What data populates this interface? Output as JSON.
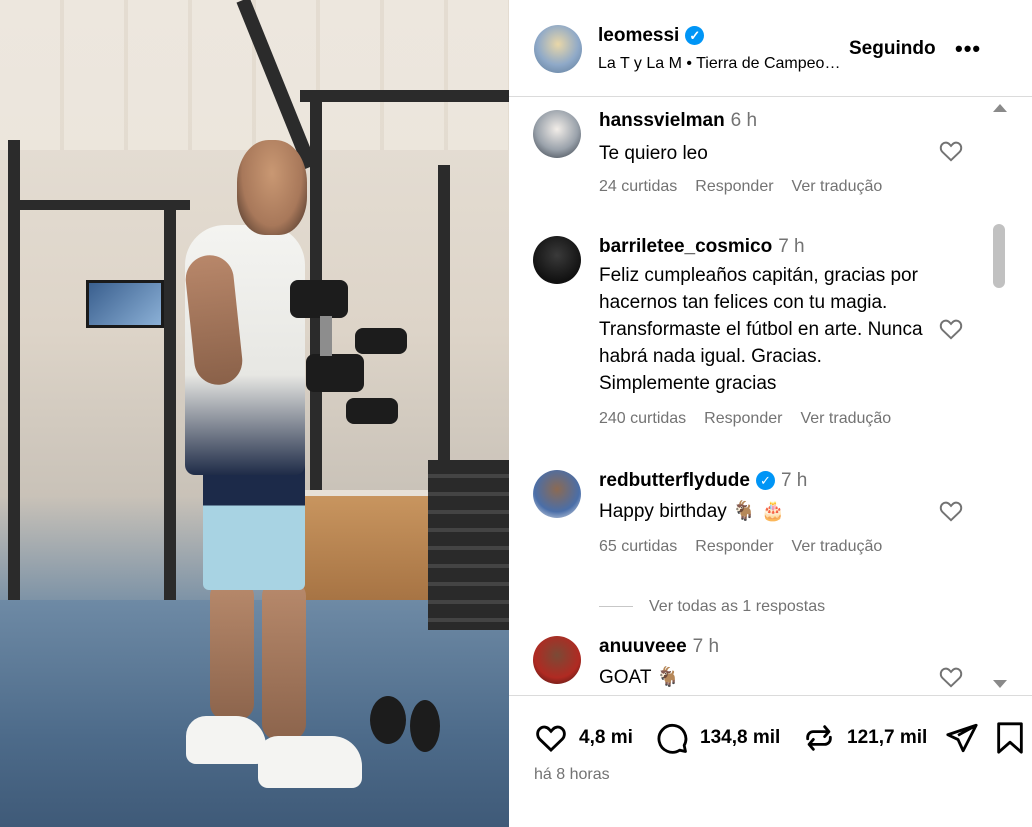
{
  "post": {
    "username": "leomessi",
    "location": "La T y La M • Tierra de Campeones",
    "follow_label": "Seguindo",
    "more_label": "•••",
    "time_ago": "há 8 horas"
  },
  "comments": [
    {
      "username": "hanssvielman",
      "time": "6 h",
      "text": "Te quiero leo",
      "likes": "24 curtidas",
      "reply_label": "Responder",
      "translate_label": "Ver tradução",
      "verified": false
    },
    {
      "username": "barriletee_cosmico",
      "time": "7 h",
      "text": "Feliz cumpleaños capitán, gracias por hacernos tan felices con tu magia. Transformaste el fútbol en arte. Nunca habrá nada igual. Gracias. Simplemente gracias",
      "likes": "240 curtidas",
      "reply_label": "Responder",
      "translate_label": "Ver tradução",
      "verified": false
    },
    {
      "username": "redbutterflydude",
      "time": "7 h",
      "text": "Happy birthday 🐐 🎂",
      "likes": "65 curtidas",
      "reply_label": "Responder",
      "translate_label": "Ver tradução",
      "verified": true,
      "view_replies": "Ver todas as 1 respostas"
    },
    {
      "username": "anuuveee",
      "time": "7 h",
      "text": "GOAT 🐐",
      "verified": false
    }
  ],
  "actions": {
    "likes": "4,8 mi",
    "comments": "134,8 mil",
    "reposts": "121,7 mil"
  },
  "icons": {
    "verified": "verified-badge-icon",
    "like": "heart-icon",
    "comment": "comment-bubble-icon",
    "repost": "repost-icon",
    "share": "share-paper-plane-icon",
    "save": "bookmark-icon"
  },
  "colors": {
    "verified_blue": "#0095f6",
    "secondary_text": "#737373",
    "divider": "#dbdbdb"
  }
}
